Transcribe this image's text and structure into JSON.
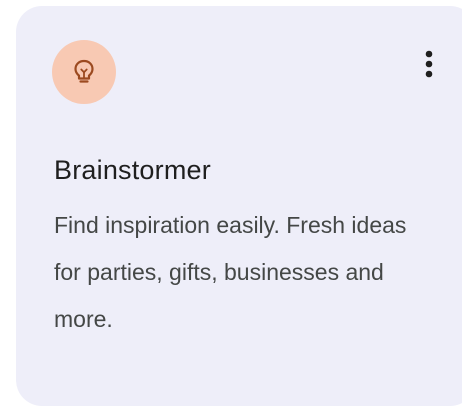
{
  "card": {
    "icon": "lightbulb-icon",
    "menu_icon": "more-vert-icon",
    "title": "Brainstormer",
    "description": "Find inspiration easily. Fresh ideas for parties, gifts, businesses and more."
  },
  "colors": {
    "card_background": "#eeeef9",
    "icon_badge_background": "#f8c9b3",
    "icon_color": "#9c4a20",
    "title_color": "#1f1f1f",
    "description_color": "#444746"
  }
}
